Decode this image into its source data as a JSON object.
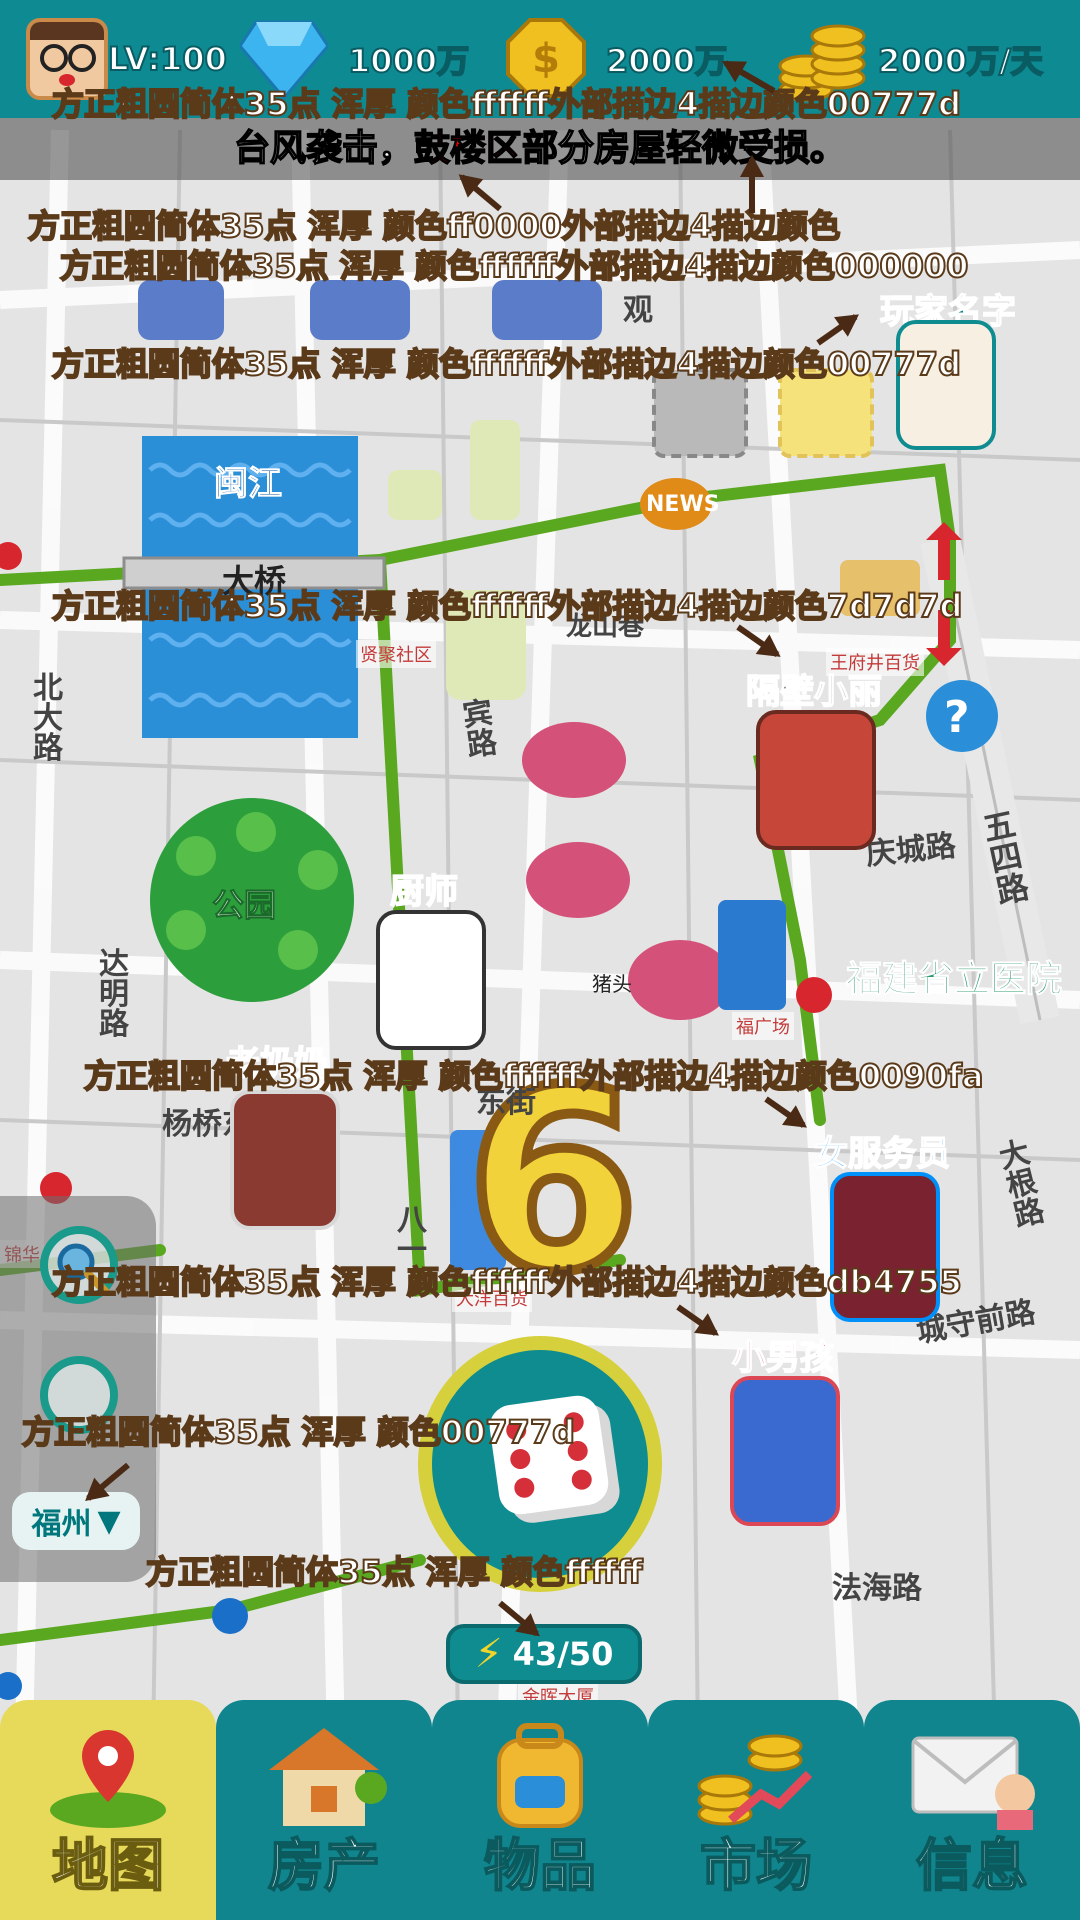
{
  "hud": {
    "level": "LV:100",
    "gems": "1000万",
    "coins": "2000万",
    "income": "2000万/天"
  },
  "ticker": {
    "prefix": "台风袭击，",
    "highlight": "鼓楼区",
    "suffix": "部分房屋轻微受损。"
  },
  "annotations": [
    {
      "id": "n1",
      "text": "方正粗圆简体35点    浑厚    颜色ffffff外部描边4描边颜色00777d"
    },
    {
      "id": "n2",
      "text": "方正粗圆简体35点    浑厚    颜色ff0000外部描边4描边颜色"
    },
    {
      "id": "n3",
      "text": "方正粗圆简体35点    浑厚    颜色ffffff外部描边4描边颜色000000"
    },
    {
      "id": "n4",
      "text": "方正粗圆简体35点    浑厚    颜色ffffff外部描边4描边颜色00777d"
    },
    {
      "id": "n5",
      "text": "方正粗圆简体35点    浑厚    颜色ffffff外部描边4描边颜色7d7d7d"
    },
    {
      "id": "n6",
      "text": "方正粗圆简体35点    浑厚    颜色ffffff外部描边4描边颜色0090fa"
    },
    {
      "id": "n7",
      "text": "方正粗圆简体35点    浑厚    颜色ffffff外部描边4描边颜色db4755"
    },
    {
      "id": "n8",
      "text": "方正粗圆简体35点    浑厚    颜色00777d"
    },
    {
      "id": "n9",
      "text": "方正粗圆简体35点    浑厚    颜色ffffff"
    }
  ],
  "map": {
    "river_name": "闽江",
    "bridge_name": "大桥",
    "park_name": "公园",
    "news_badge": "NEWS",
    "roads": {
      "wusi": "五四路",
      "beida": "北大路",
      "qingcheng": "庆城路",
      "dada": "达明路",
      "fahai": "法海路",
      "chengshou": "城守前路",
      "dagen": "大根路",
      "dongjie": "东街",
      "bawu": "八一",
      "yangqiao": "杨桥东",
      "longshan": "龙山巷",
      "dongjie2": "东街",
      "guan": "观",
      "bin": "宾路"
    },
    "pois": {
      "wangfu": "王府井百货",
      "xianju": "贤聚社区",
      "dafu": "福广场",
      "jinhui": "金晖大厦",
      "hospital": "福建省立医院",
      "zhutou": "猪头",
      "jinyu": "锦华",
      "tianfu": "大洋百货"
    }
  },
  "characters": {
    "player": "玩家名字",
    "neighbor": "隔壁小丽",
    "chef": "厨师",
    "grandma": "老奶奶",
    "waitress": "女服务员",
    "boy": "小男孩"
  },
  "dice": {
    "rolled_number": "6"
  },
  "city": {
    "selected": "福州",
    "caret": "▼"
  },
  "energy": {
    "current": "43/50"
  },
  "nav": {
    "tabs": [
      {
        "label": "地图"
      },
      {
        "label": "房产"
      },
      {
        "label": "物品"
      },
      {
        "label": "市场"
      },
      {
        "label": "信息"
      }
    ]
  },
  "colors": {
    "teal": "#0f8c90",
    "active_tab": "#e7d95a",
    "red_highlight": "#ff0000",
    "road_green": "#5aa820"
  }
}
